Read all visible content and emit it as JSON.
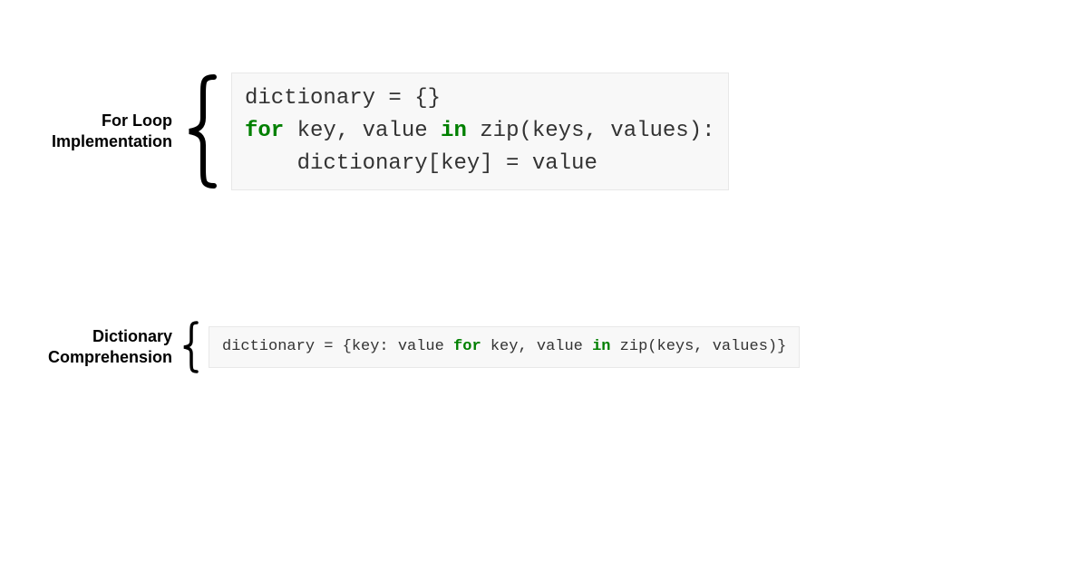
{
  "section1": {
    "label_line1": "For Loop",
    "label_line2": "Implementation",
    "code": {
      "line1_a": "dictionary = {}",
      "line2_a": "for",
      "line2_b": " key, value ",
      "line2_c": "in",
      "line2_d": " zip(keys, values):",
      "line3_a": "    dictionary[key] = value"
    }
  },
  "section2": {
    "label_line1": "Dictionary",
    "label_line2": "Comprehension",
    "code": {
      "line1_a": "dictionary = {key: value ",
      "line1_b": "for",
      "line1_c": " key, value ",
      "line1_d": "in",
      "line1_e": " zip(keys, values)}"
    }
  }
}
